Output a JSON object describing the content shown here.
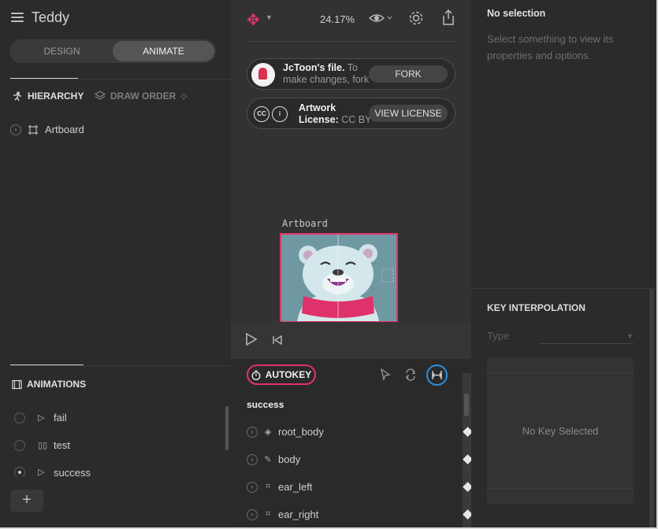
{
  "app": {
    "title": "Teddy"
  },
  "mode": {
    "design": "DESIGN",
    "animate": "ANIMATE"
  },
  "hierarchy": {
    "tab_hierarchy": "HIERARCHY",
    "tab_draw_order": "DRAW ORDER",
    "items": [
      {
        "label": "Artboard"
      }
    ]
  },
  "animations": {
    "header": "ANIMATIONS",
    "items": [
      {
        "label": "fail",
        "selected": false
      },
      {
        "label": "test",
        "selected": false
      },
      {
        "label": "success",
        "selected": true
      }
    ],
    "add_label": "+"
  },
  "toolbar": {
    "zoom": "24.17%"
  },
  "fork_card": {
    "owner": "JcToon's file.",
    "text": " To make changes, fork",
    "button": "FORK"
  },
  "license_card": {
    "label": "Artwork License:",
    "value": " CC BY",
    "button": "VIEW LICENSE",
    "cc_icon": "CC",
    "by_icon": "i"
  },
  "stage": {
    "artboard_label": "Artboard"
  },
  "timeline": {
    "autokey": "AUTOKEY",
    "animation_name": "success",
    "tracks": [
      {
        "label": "root_body",
        "icon": "◈"
      },
      {
        "label": "body",
        "icon": "✎"
      },
      {
        "label": "ear_left",
        "icon": "⌗"
      },
      {
        "label": "ear_right",
        "icon": "⌗"
      }
    ]
  },
  "inspector": {
    "title": "No selection",
    "hint": "Select something to view its properties and options."
  },
  "key_interpolation": {
    "title": "KEY INTERPOLATION",
    "type_label": "Type",
    "empty": "No Key Selected"
  },
  "colors": {
    "accent": "#e0326a",
    "active_blue": "#2f8fe0",
    "bg": "#2b2b2b"
  }
}
